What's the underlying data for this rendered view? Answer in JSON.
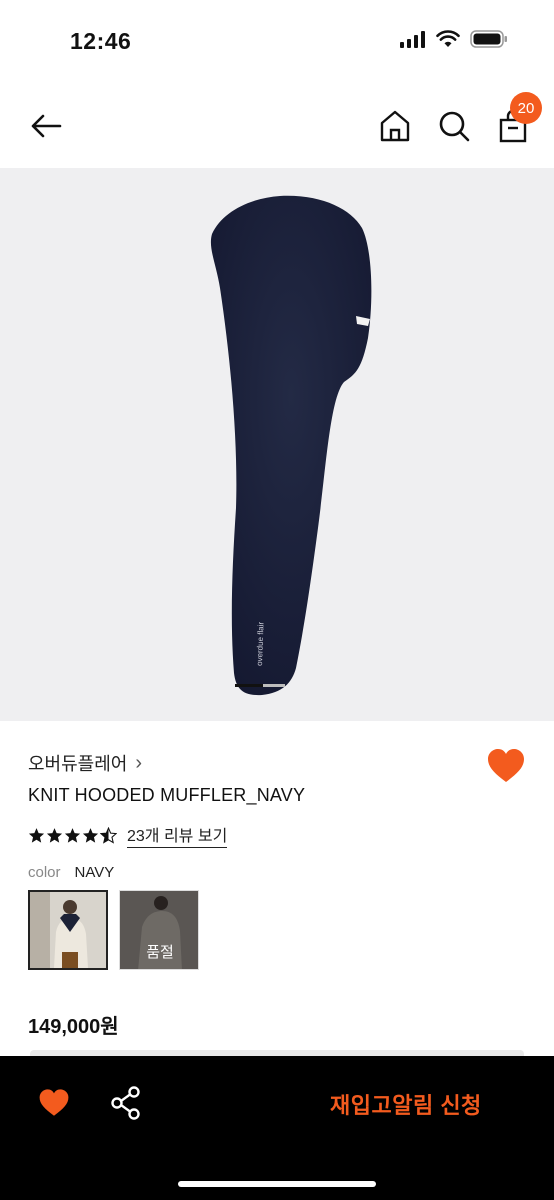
{
  "status_bar": {
    "time": "12:46"
  },
  "nav": {
    "cart_count": "20"
  },
  "product": {
    "brand": "오버듀플레어",
    "brand_chevron": "›",
    "name": "KNIT HOODED MUFFLER_NAVY",
    "rating": 4.5,
    "review_link": "23개 리뷰 보기",
    "color_label": "color",
    "color_value": "NAVY",
    "soldout_label": "품절",
    "price": "149,000원"
  },
  "bottom_bar": {
    "restock_button": "재입고알림 신청"
  },
  "colors": {
    "accent": "#f35b1e",
    "navy": "#1c2237"
  }
}
